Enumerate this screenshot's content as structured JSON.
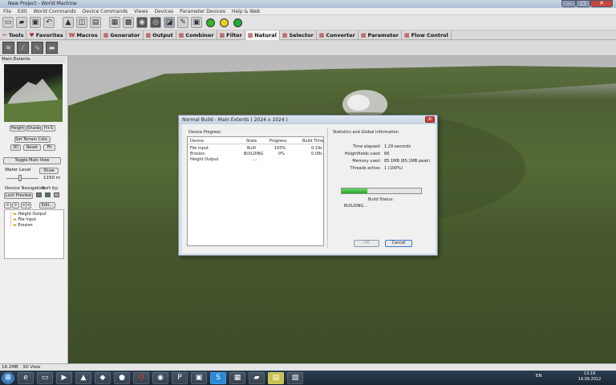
{
  "window": {
    "title": "New Project - World Machine",
    "min": "–",
    "max": "□",
    "close": "✕"
  },
  "menu": [
    "File",
    "Edit",
    "World Commands",
    "Device Commands",
    "Views",
    "Devices",
    "Parameter Devices",
    "Help & Web"
  ],
  "toolbar_icons": [
    "new-icon",
    "open-icon",
    "save-icon",
    "undo-icon",
    "build-icon",
    "device-icon",
    "parameter-icon",
    "layout-icon",
    "grid-icon",
    "view-icon",
    "explore-icon",
    "camera-icon",
    "settings-icon",
    "stop-icon",
    "green-light-icon",
    "yellow-light-icon",
    "green-go-icon"
  ],
  "tabs": [
    {
      "label": "Tools",
      "icon": "✂"
    },
    {
      "label": "Favorites",
      "icon": "♥"
    },
    {
      "label": "Macros",
      "icon": "W"
    },
    {
      "label": "Generator",
      "icon": "▦"
    },
    {
      "label": "Output",
      "icon": "▦"
    },
    {
      "label": "Combiner",
      "icon": "▦"
    },
    {
      "label": "Filter",
      "icon": "▦"
    },
    {
      "label": "Natural",
      "icon": "▦"
    },
    {
      "label": "Selector",
      "icon": "▦"
    },
    {
      "label": "Converter",
      "icon": "▦"
    },
    {
      "label": "Parameter",
      "icon": "▦"
    },
    {
      "label": "Flow Control",
      "icon": "▦"
    }
  ],
  "left": {
    "header": "Main Extents",
    "btn_height": "Height",
    "btn_shade": "Shade",
    "btn_hs": "H+S",
    "btn_set_terrain": "Set Terrain Colo..",
    "btn_3d": "3D",
    "btn_reset": "Reset",
    "btn_fit": "Fit",
    "btn_toggle": "Toggle Main View",
    "water_level": "Water Level",
    "btn_show": "Show",
    "water_value": "1150 m",
    "device_nav": "Device Navigation",
    "sort_by": "Sort by:",
    "btn_lock": "Lock Preview",
    "btn_edit": "Edit...",
    "nav_prev": "<",
    "nav_next": ">",
    "nav_jump": ">|<",
    "tree": [
      "Height Output",
      "File Input",
      "Erosion"
    ]
  },
  "dialog": {
    "title": "Normal Build - Main Extents ( 2024 x 1024 )",
    "close": "✕",
    "device_progress": "Device Progress",
    "cols": [
      "Device",
      "State",
      "Progress",
      "Build Time"
    ],
    "rows": [
      {
        "device": "File Input",
        "state": "Built",
        "progress": "100%",
        "time": "0.19s"
      },
      {
        "device": "Erosion",
        "state": "BUILDING",
        "progress": "0%",
        "time": "0.08s"
      },
      {
        "device": "Height Output",
        "state": "....",
        "progress": "",
        "time": ""
      }
    ],
    "stats_title": "Statistics and Global Information",
    "stats": [
      {
        "label": "Time elapsed:",
        "value": "1.29 seconds"
      },
      {
        "label": "Heightfields used:",
        "value": "66"
      },
      {
        "label": "Memory used:",
        "value": "85.1MB (85.1MB peak)"
      },
      {
        "label": "Threads active:",
        "value": "1 (100%)"
      }
    ],
    "progress_fraction": 0.32,
    "build_status_label": "Build Status:",
    "build_status": "BUILDING...",
    "ok": "OK",
    "cancel": "Cancel"
  },
  "status": {
    "memory": "18.2MB",
    "view": "3D View"
  },
  "taskbar": {
    "start": "⊞",
    "apps": [
      "ie-icon",
      "folder-icon",
      "media-icon",
      "vlc-icon",
      "app-icon",
      "firefox-icon",
      "opera-icon",
      "app2-icon",
      "app3-icon",
      "vbk-icon",
      "skype-icon",
      "world-machine-icon",
      "app4-icon",
      "notes-icon",
      "app5-icon"
    ],
    "lang": "EN",
    "time": "13:19",
    "date": "14.09.2012"
  }
}
